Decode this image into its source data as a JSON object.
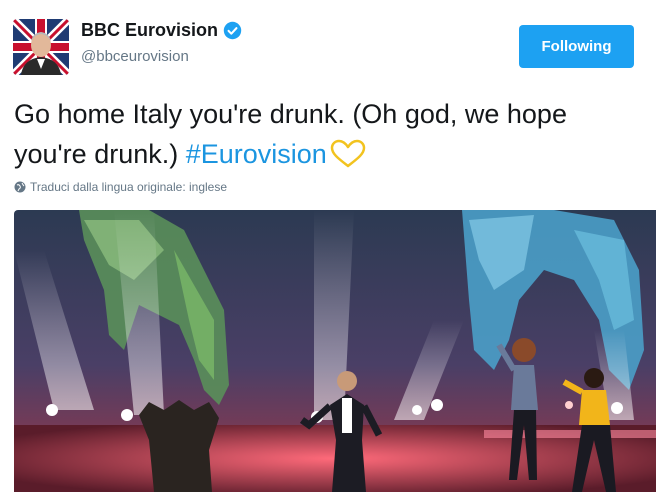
{
  "account": {
    "name": "BBC Eurovision",
    "handle": "@bbceurovision",
    "verified": true,
    "avatar_icon": "user-avatar-icon"
  },
  "follow_button": {
    "label": "Following",
    "color": "#1da1f2"
  },
  "tweet": {
    "text": "Go home Italy you're drunk. (Oh god, we hope you're drunk.)",
    "hashtag": "#Eurovision",
    "emoji_icon": "yellow-heart-icon",
    "hashtag_color": "#1b95e0"
  },
  "translate_link": {
    "label": "Traduci dalla lingua originale: inglese",
    "icon": "globe-icon"
  },
  "media": {
    "type": "photo",
    "icon": "stage-photo"
  }
}
